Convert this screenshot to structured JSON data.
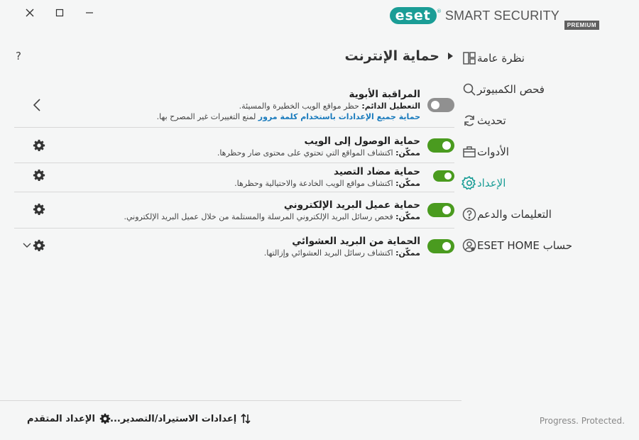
{
  "window": {
    "brand_logo": "eset",
    "brand_name": "SMART SECURITY",
    "brand_edition": "PREMIUM",
    "close_icon": "close-icon",
    "maximize_icon": "maximize-icon",
    "minimize_icon": "minimize-icon"
  },
  "sidebar": {
    "items": [
      {
        "label": "نظرة عامة",
        "icon": "overview-icon",
        "active": false
      },
      {
        "label": "فحص الكمبيوتر",
        "icon": "search-icon",
        "active": false
      },
      {
        "label": "تحديث",
        "icon": "refresh-icon",
        "active": false
      },
      {
        "label": "الأدوات",
        "icon": "toolbox-icon",
        "active": false
      },
      {
        "label": "الإعداد",
        "icon": "gear-icon",
        "active": true
      },
      {
        "label": "التعليمات والدعم",
        "icon": "help-icon",
        "active": false
      },
      {
        "label": "حساب ESET HOME",
        "icon": "account-icon",
        "active": false
      }
    ],
    "accent_color": "#1a9d96"
  },
  "main": {
    "title": "حماية الإنترنت",
    "help_label": "?",
    "modules": [
      {
        "title": "المراقبة الأبوية",
        "status_label": "التعطيل الدائم:",
        "status_desc": " حظر مواقع الويب الخطيرة والمسيئة.",
        "link_text": "حماية جميع الإعدادات باستخدام كلمة مرور",
        "link_suffix": " لمنع التغييرات غير المصرح بها.",
        "enabled": false
      },
      {
        "title": "حماية الوصول إلى الويب",
        "status_label": "ممكّن:",
        "status_desc": " اكتشاف المواقع التي تحتوي على محتوى ضار وحظرها.",
        "enabled": true
      },
      {
        "title": "حماية مضاد التصيد",
        "status_label": "ممكّن:",
        "status_desc": " اكتشاف مواقع الويب الخادعة والاحتيالية وحظرها.",
        "enabled": true
      },
      {
        "title": "حماية عميل البريد الإلكتروني",
        "status_label": "ممكّن:",
        "status_desc": " فحص رسائل البريد الإلكتروني المرسلة والمستلمة من خلال عميل البريد الإلكتروني.",
        "enabled": true
      },
      {
        "title": "الحماية من البريد العشوائي",
        "status_label": "ممكّن:",
        "status_desc": " اكتشاف رسائل البريد العشوائي وإزالتها.",
        "enabled": true
      }
    ],
    "toggle_on_color": "#4a9b1f",
    "toggle_off_color": "#909090"
  },
  "footer": {
    "import_export_label": "إعدادات الاستيراد/التصدير...",
    "advanced_setup_label": "الإعداد المتقدم",
    "tagline": "Progress. Protected."
  }
}
